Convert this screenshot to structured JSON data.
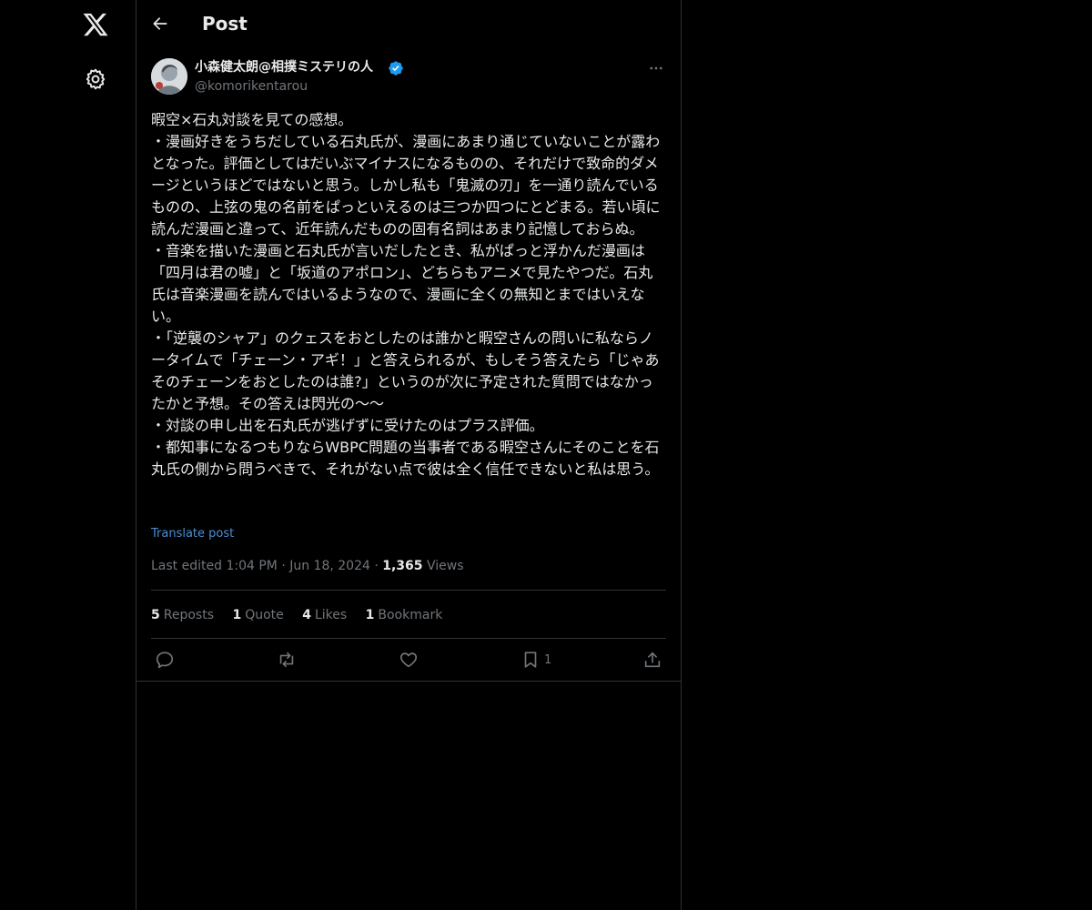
{
  "nav": {
    "logo_icon": "x-logo-icon",
    "settings_icon": "gear-icon"
  },
  "header": {
    "title": "Post"
  },
  "post": {
    "author_name": "小森健太朗@相撲ミステリの人",
    "author_handle": "@komorikentarou",
    "verified": true,
    "text": "暇空×石丸対談を見ての感想。\n・漫画好きをうちだしている石丸氏が、漫画にあまり通じていないことが露わとなった。評価としてはだいぶマイナスになるものの、それだけで致命的ダメージというほどではないと思う。しかし私も「鬼滅の刃」を一通り読んでいるものの、上弦の鬼の名前をぱっといえるのは三つか四つにとどまる。若い頃に読んだ漫画と違って、近年読んだものの固有名詞はあまり記憶しておらぬ。\n・音楽を描いた漫画と石丸氏が言いだしたとき、私がぱっと浮かんだ漫画は「四月は君の嘘」と「坂道のアポロン」、どちらもアニメで見たやつだ。石丸氏は音楽漫画を読んではいるようなので、漫画に全くの無知とまではいえない。\n・「逆襲のシャア」のクェスをおとしたのは誰かと暇空さんの問いに私ならノータイムで「チェーン・アギ！」と答えられるが、もしそう答えたら「じゃあそのチェーンをおとしたのは誰?」というのが次に予定された質問ではなかったかと予想。その答えは閃光の〜〜\n・対談の申し出を石丸氏が逃げずに受けたのはプラス評価。\n・都知事になるつもりならWBPC問題の当事者である暇空さんにそのことを石丸氏の側から問うべきで、それがない点で彼は全く信任できないと私は思う。",
    "translate_label": "Translate post",
    "edited_label": "Last edited 1:04 PM",
    "separator": "·",
    "date": "Jun 18, 2024",
    "views_count": "1,365",
    "views_label": "Views"
  },
  "stats": {
    "reposts_count": "5",
    "reposts_label": "Reposts",
    "quotes_count": "1",
    "quotes_label": "Quote",
    "likes_count": "4",
    "likes_label": "Likes",
    "bookmarks_count": "1",
    "bookmarks_label": "Bookmark"
  },
  "actions": {
    "reply_icon": "reply-icon",
    "repost_icon": "repost-icon",
    "like_icon": "heart-icon",
    "bookmark_icon": "bookmark-icon",
    "bookmark_count": "1",
    "share_icon": "share-icon"
  },
  "colors": {
    "background": "#000000",
    "text_primary": "#e7e9ea",
    "text_secondary": "#71767b",
    "border": "#2f3336",
    "link": "#4c8fd6",
    "verified_badge": "#1d9bf0"
  }
}
